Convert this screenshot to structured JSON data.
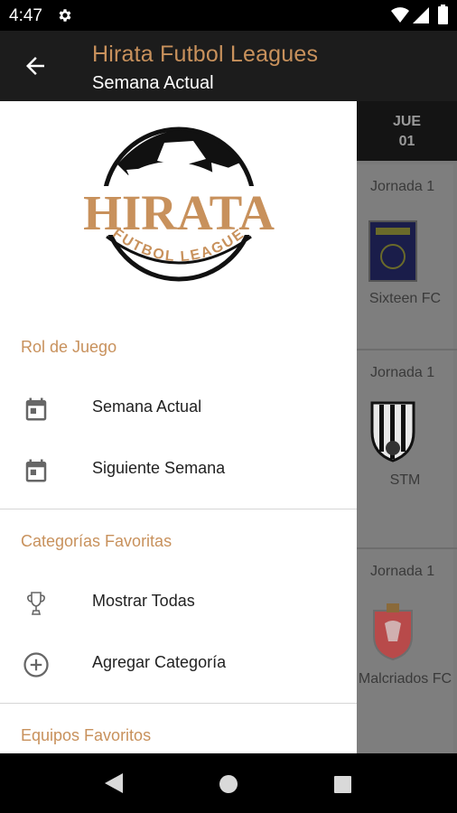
{
  "status_bar": {
    "time": "4:47"
  },
  "app_bar": {
    "title": "Hirata Futbol Leagues",
    "subtitle": "Semana Actual"
  },
  "logo": {
    "name": "HIRATA",
    "tagline": "FUTBOL LEAGUE"
  },
  "day_tab": {
    "day": "JUE",
    "date": "01"
  },
  "matches": [
    {
      "jornada": "Jornada 1",
      "team": "Sixteen FC"
    },
    {
      "jornada": "Jornada 1",
      "team": "STM"
    },
    {
      "jornada": "Jornada 1",
      "team": "Malcriados FC"
    }
  ],
  "drawer": {
    "sections": [
      {
        "header": "Rol de Juego",
        "items": [
          {
            "label": "Semana Actual",
            "icon": "calendar-icon"
          },
          {
            "label": "Siguiente Semana",
            "icon": "calendar-icon"
          }
        ]
      },
      {
        "header": "Categorías Favoritas",
        "items": [
          {
            "label": "Mostrar Todas",
            "icon": "trophy-icon"
          },
          {
            "label": "Agregar Categoría",
            "icon": "add-circle-icon"
          }
        ]
      },
      {
        "header": "Equipos Favoritos",
        "items": []
      }
    ]
  },
  "colors": {
    "accent": "#c8915c",
    "app_bar_bg": "#1c1c1c",
    "drawer_bg": "#ffffff",
    "scrim": "#7a7a7a"
  }
}
